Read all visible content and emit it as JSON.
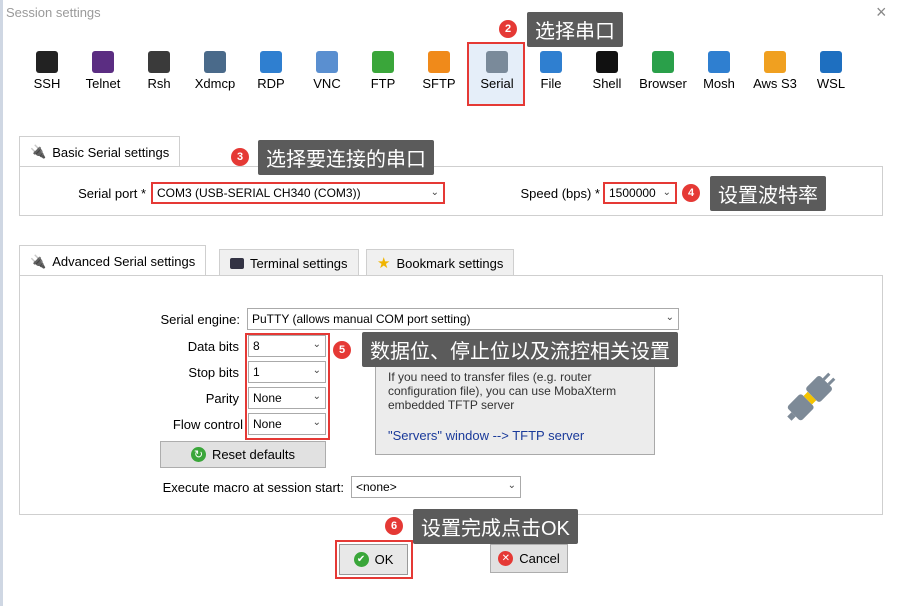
{
  "window": {
    "title": "Session settings",
    "close": "×"
  },
  "protocols": [
    {
      "label": "SSH",
      "icon": "ssh-icon",
      "color": "#222222"
    },
    {
      "label": "Telnet",
      "icon": "telnet-icon",
      "color": "#5b2d82"
    },
    {
      "label": "Rsh",
      "icon": "rsh-icon",
      "color": "#3a3a3a"
    },
    {
      "label": "Xdmcp",
      "icon": "xdmcp-icon",
      "color": "#4a6a8a"
    },
    {
      "label": "RDP",
      "icon": "rdp-icon",
      "color": "#2f7fd0"
    },
    {
      "label": "VNC",
      "icon": "vnc-icon",
      "color": "#5a8fd0"
    },
    {
      "label": "FTP",
      "icon": "ftp-icon",
      "color": "#3aa63a"
    },
    {
      "label": "SFTP",
      "icon": "sftp-icon",
      "color": "#f08a1a"
    },
    {
      "label": "Serial",
      "icon": "serial-icon",
      "color": "#7a8a9a"
    },
    {
      "label": "File",
      "icon": "file-icon",
      "color": "#2f7fd0"
    },
    {
      "label": "Shell",
      "icon": "shell-icon",
      "color": "#111111"
    },
    {
      "label": "Browser",
      "icon": "browser-icon",
      "color": "#2aa04a"
    },
    {
      "label": "Mosh",
      "icon": "mosh-icon",
      "color": "#2f7fd0"
    },
    {
      "label": "Aws S3",
      "icon": "aws-s3-icon",
      "color": "#f0a020"
    },
    {
      "label": "WSL",
      "icon": "wsl-icon",
      "color": "#1e6fc0"
    }
  ],
  "basic": {
    "tab_label": "Basic Serial settings",
    "serial_port_label": "Serial port *",
    "serial_port_value": "COM3  (USB-SERIAL CH340 (COM3))",
    "speed_label": "Speed (bps) *",
    "speed_value": "1500000"
  },
  "advanced": {
    "tabs": [
      "Advanced Serial settings",
      "Terminal settings",
      "Bookmark settings"
    ],
    "engine_label": "Serial engine:",
    "engine_value": "PuTTY    (allows manual COM port setting)",
    "data_bits_label": "Data bits",
    "data_bits_value": "8",
    "stop_bits_label": "Stop bits",
    "stop_bits_value": "1",
    "parity_label": "Parity",
    "parity_value": "None",
    "flow_label": "Flow control",
    "flow_value": "None",
    "reset_label": "Reset defaults",
    "macro_label": "Execute macro at session start:",
    "macro_value": "<none>",
    "info_line1": "If you need to transfer files (e.g. router",
    "info_line2": "configuration file), you can use MobaXterm",
    "info_line3": "embedded TFTP server",
    "info_link": "\"Servers\" window  -->  TFTP server"
  },
  "buttons": {
    "ok": "OK",
    "cancel": "Cancel"
  },
  "annotations": {
    "b2": "2",
    "c2": "选择串口",
    "b3": "3",
    "c3": "选择要连接的串口",
    "b4": "4",
    "c4": "设置波特率",
    "b5": "5",
    "c5": "数据位、停止位以及流控相关设置",
    "b6": "6",
    "c6": "设置完成点击OK"
  },
  "colors": {
    "highlight": "#e53935",
    "callout": "#5b5b5b",
    "link": "#1a3a9a"
  }
}
